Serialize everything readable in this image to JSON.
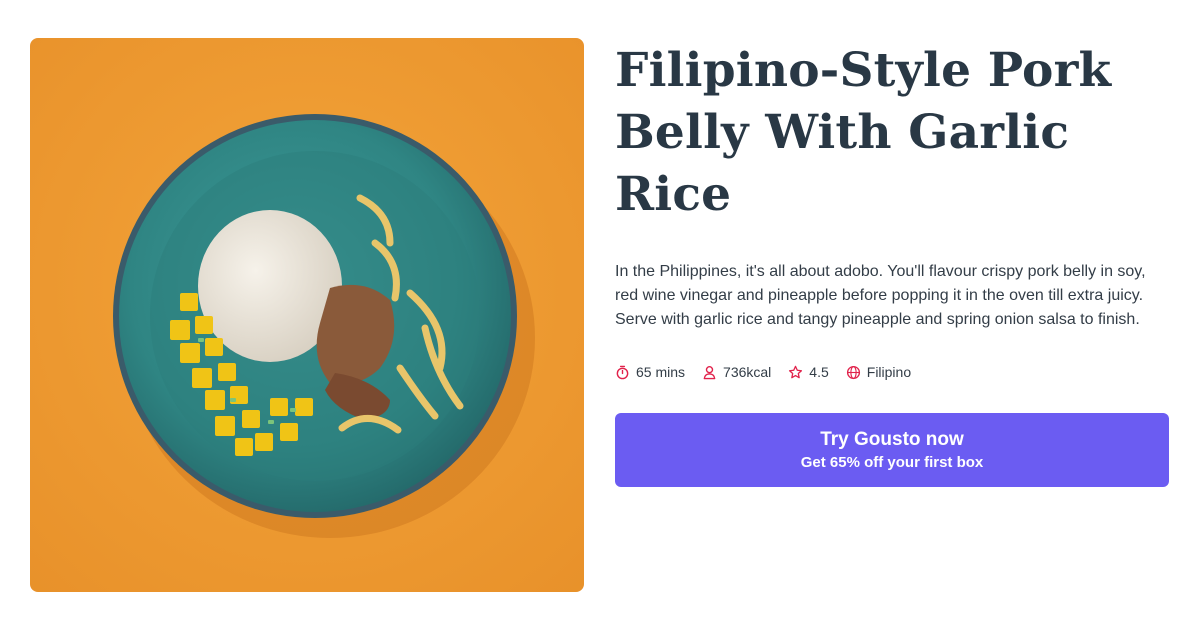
{
  "recipe": {
    "title": "Filipino-Style Pork Belly With Garlic Rice",
    "description": "In the Philippines, it's all about adobo. You'll flavour crispy pork belly in soy, red wine vinegar and pineapple before popping it in the oven till extra juicy. Serve with garlic rice and tangy pineapple and spring onion salsa to finish.",
    "image_description": "Overhead photo of a teal plate with a dome of garlic rice, sliced pork belly with onions, and diced pineapple salsa on an orange background"
  },
  "meta": {
    "time": {
      "text": "65 mins",
      "icon": "stopwatch-icon"
    },
    "calories": {
      "text": "736kcal",
      "icon": "person-icon"
    },
    "rating": {
      "text": "4.5",
      "icon": "star-icon"
    },
    "cuisine": {
      "text": "Filipino",
      "icon": "globe-icon"
    }
  },
  "cta": {
    "label": "Try Gousto now",
    "sublabel": "Get 65% off your first box"
  },
  "colors": {
    "accent": "#6b5cf2",
    "icon": "#e1224b",
    "title": "#293845",
    "text": "#333d47",
    "background": "#ffffff"
  }
}
